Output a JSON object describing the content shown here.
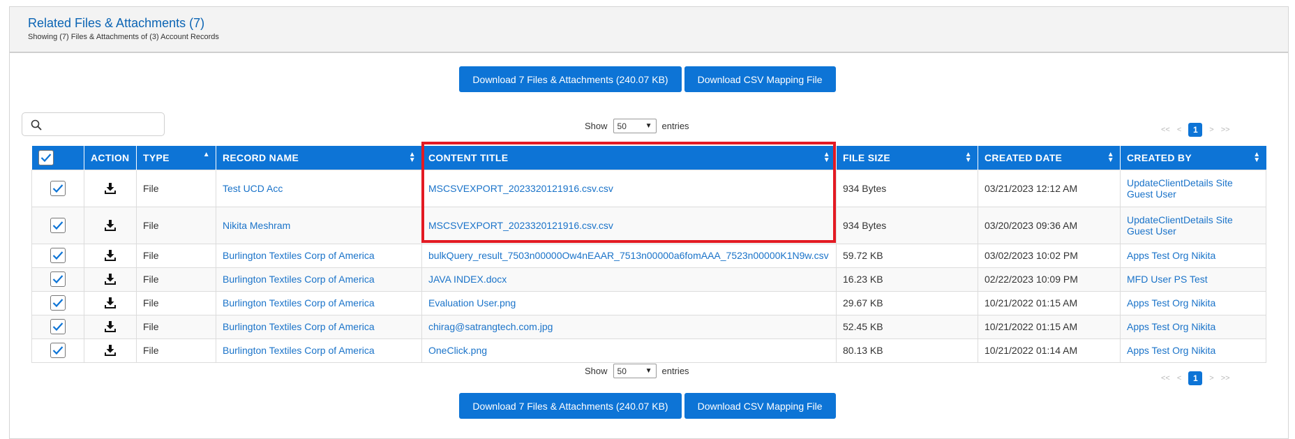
{
  "header": {
    "title": "Related Files & Attachments (7)",
    "subtitle": "Showing (7) Files & Attachments of (3) Account Records"
  },
  "buttons": {
    "download_all": "Download 7 Files & Attachments (240.07 KB)",
    "download_csv": "Download CSV Mapping File"
  },
  "search": {
    "value": "",
    "placeholder": ""
  },
  "length_control": {
    "show_label": "Show",
    "selected": "50",
    "entries_label": "entries"
  },
  "pagination": {
    "first": "<<",
    "prev": "<",
    "current": "1",
    "next": ">",
    "last": ">>"
  },
  "table": {
    "columns": [
      "ACTION",
      "TYPE",
      "RECORD NAME",
      "CONTENT TITLE",
      "FILE SIZE",
      "CREATED DATE",
      "CREATED BY"
    ],
    "rows": [
      {
        "type": "File",
        "record_name": "Test UCD Acc",
        "content_title": "MSCSVEXPORT_2023320121916.csv.csv",
        "file_size": "934 Bytes",
        "created_date": "03/21/2023 12:12 AM",
        "created_by": "UpdateClientDetails Site Guest User"
      },
      {
        "type": "File",
        "record_name": "Nikita Meshram",
        "content_title": "MSCSVEXPORT_2023320121916.csv.csv",
        "file_size": "934 Bytes",
        "created_date": "03/20/2023 09:36 AM",
        "created_by": "UpdateClientDetails Site Guest User"
      },
      {
        "type": "File",
        "record_name": "Burlington Textiles Corp of America",
        "content_title": "bulkQuery_result_7503n00000Ow4nEAAR_7513n00000a6fomAAA_7523n00000K1N9w.csv",
        "file_size": "59.72 KB",
        "created_date": "03/02/2023 10:02 PM",
        "created_by": "Apps Test Org Nikita"
      },
      {
        "type": "File",
        "record_name": "Burlington Textiles Corp of America",
        "content_title": "JAVA INDEX.docx",
        "file_size": "16.23 KB",
        "created_date": "02/22/2023 10:09 PM",
        "created_by": "MFD User PS Test"
      },
      {
        "type": "File",
        "record_name": "Burlington Textiles Corp of America",
        "content_title": "Evaluation User.png",
        "file_size": "29.67 KB",
        "created_date": "10/21/2022 01:15 AM",
        "created_by": "Apps Test Org Nikita"
      },
      {
        "type": "File",
        "record_name": "Burlington Textiles Corp of America",
        "content_title": "chirag@satrangtech.com.jpg",
        "file_size": "52.45 KB",
        "created_date": "10/21/2022 01:15 AM",
        "created_by": "Apps Test Org Nikita"
      },
      {
        "type": "File",
        "record_name": "Burlington Textiles Corp of America",
        "content_title": "OneClick.png",
        "file_size": "80.13 KB",
        "created_date": "10/21/2022 01:14 AM",
        "created_by": "Apps Test Org Nikita"
      }
    ]
  },
  "colors": {
    "accent": "#0d74d6",
    "link": "#1a73c9",
    "highlight": "#e31a23"
  },
  "icons": [
    "search-icon",
    "download-icon",
    "checkmark-icon",
    "sort-icon"
  ]
}
